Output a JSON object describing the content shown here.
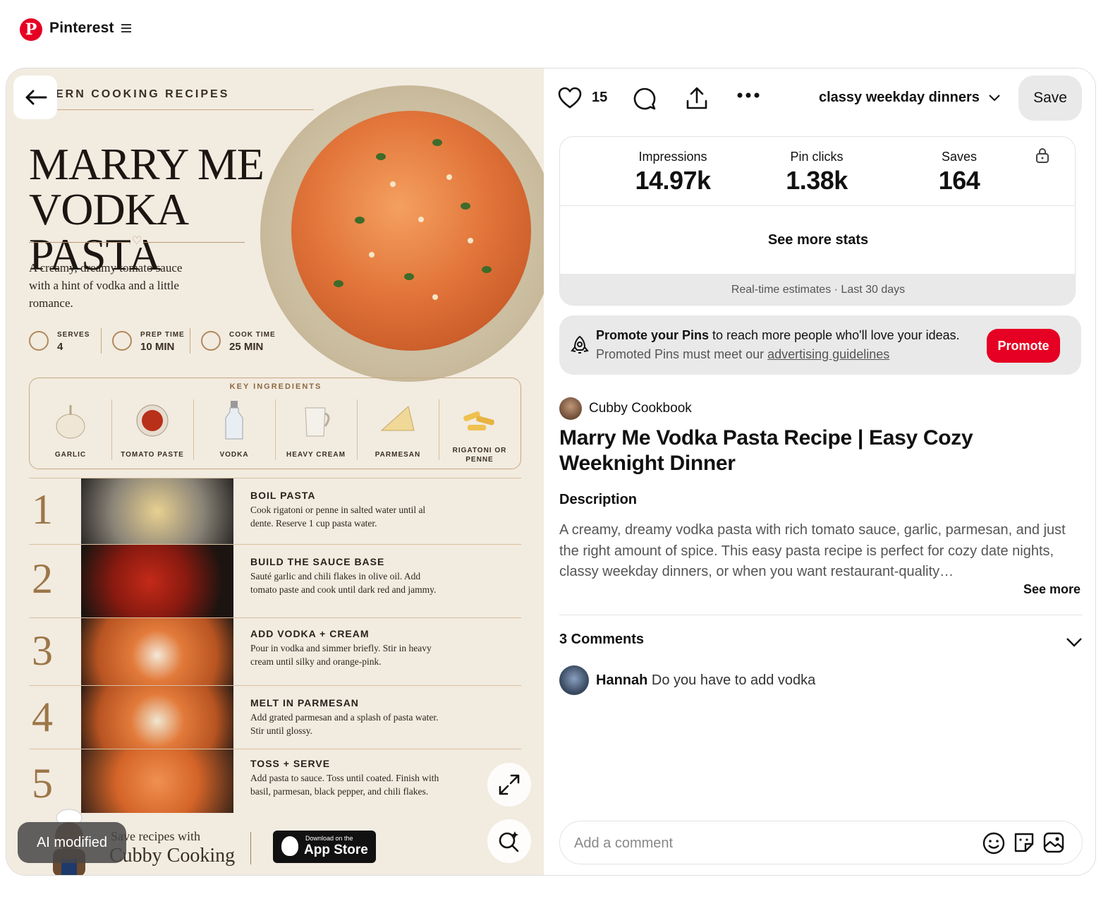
{
  "header": {
    "logo_letter": "P",
    "brand": "Pinterest",
    "menu_icon": "hamburger-icon"
  },
  "pin_image": {
    "eyebrow": "ERN COOKING RECIPES",
    "title": "MARRY ME VODKA PASTA",
    "intro": "A creamy, dreamy tomato sauce with a hint of vodka and a little romance.",
    "stats": [
      {
        "label": "SERVES",
        "value": "4",
        "icon": "people-icon"
      },
      {
        "label": "PREP TIME",
        "value": "10 MIN",
        "icon": "clock-icon"
      },
      {
        "label": "COOK TIME",
        "value": "25 MIN",
        "icon": "clock-icon"
      }
    ],
    "ingredients_heading": "KEY INGREDIENTS",
    "ingredients": [
      "GARLIC",
      "TOMATO PASTE",
      "VODKA",
      "HEAVY CREAM",
      "PARMESAN",
      "RIGATONI OR PENNE"
    ],
    "steps": [
      {
        "num": "1",
        "title": "BOIL PASTA",
        "body": "Cook rigatoni or penne in salted water until al dente. Reserve 1 cup pasta water."
      },
      {
        "num": "2",
        "title": "BUILD THE SAUCE BASE",
        "body": "Sauté garlic and chili flakes in olive oil. Add tomato paste and cook until dark red and jammy."
      },
      {
        "num": "3",
        "title": "ADD VODKA + CREAM",
        "body": "Pour in vodka and simmer briefly. Stir in heavy cream until silky and orange-pink."
      },
      {
        "num": "4",
        "title": "MELT IN PARMESAN",
        "body": "Add grated parmesan and a splash of pasta water. Stir until glossy."
      },
      {
        "num": "5",
        "title": "TOSS + SERVE",
        "body": "Add pasta to sauce. Toss until coated. Finish with basil, parmesan, black pepper, and chili flakes."
      }
    ],
    "footer_text": "Save recipes with",
    "footer_brand": "Cubby Cooking",
    "appstore_small": "Download on the",
    "appstore_big": "App Store",
    "ai_badge": "AI modified"
  },
  "actions": {
    "like_count": "15",
    "board_name": "classy weekday dinners",
    "save_label": "Save"
  },
  "stats": {
    "metrics": [
      {
        "label": "Impressions",
        "value": "14.97k"
      },
      {
        "label": "Pin clicks",
        "value": "1.38k"
      },
      {
        "label": "Saves",
        "value": "164"
      }
    ],
    "see_more_label": "See more stats",
    "footnote": "Real-time estimates · Last 30 days"
  },
  "promo": {
    "bold": "Promote your Pins",
    "rest": " to reach more people who'll love your ideas.",
    "line2_prefix": "Promoted Pins must meet our ",
    "line2_link": "advertising guidelines",
    "button": "Promote"
  },
  "pin": {
    "creator": "Cubby Cookbook",
    "title": "Marry Me Vodka Pasta Recipe | Easy Cozy Weeknight Dinner",
    "description_heading": "Description",
    "description": "A creamy, dreamy vodka pasta with rich tomato sauce, garlic, parmesan, and just the right amount of spice. This easy pasta recipe is perfect for cozy date nights, classy weekday dinners, or when you want restaurant-quality…",
    "see_more": "See more"
  },
  "comments": {
    "heading": "3 Comments",
    "items": [
      {
        "user": "Hannah",
        "text": "Do you have to add vodka"
      }
    ],
    "placeholder": "Add a comment"
  },
  "colors": {
    "brand_red": "#e60023",
    "pin_background": "#f2ebe0",
    "muted_gray": "#e9e9e9"
  }
}
